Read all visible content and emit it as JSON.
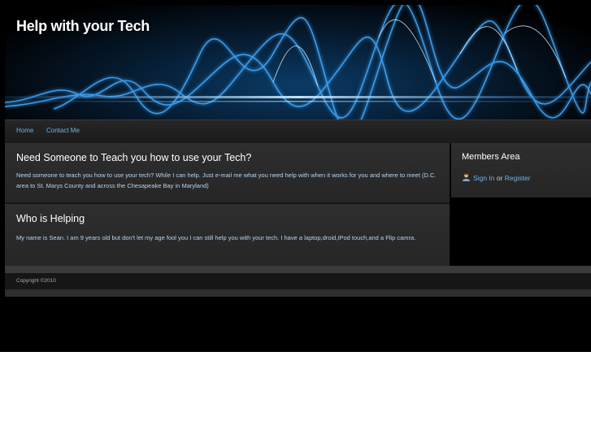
{
  "header": {
    "title": "Help with your Tech"
  },
  "nav": {
    "items": [
      {
        "label": "Home"
      },
      {
        "label": "Contact Me"
      }
    ]
  },
  "main": {
    "sections": [
      {
        "heading": "Need Someone to Teach you how to use your Tech?",
        "body": "Need someone to teach you how to use your tech? While I can help. Just e-mail me what you need help with when it works for you and where to meet (D.C. area to St. Marys County and across the Chesapeake Bay in Maryland)"
      },
      {
        "heading": "Who is Helping",
        "body": "My name is Sean. I am 9 years old but don't let my age fool you I can still help you with your tech. I have a laptop,droid,IPod touch,and a Flip camra."
      }
    ]
  },
  "sidebar": {
    "title": "Members Area",
    "sign_in": "Sign In",
    "or": "or",
    "register": "Register",
    "icon": "user-icon"
  },
  "footer": {
    "copyright": "Copyright ©2010"
  },
  "colors": {
    "link": "#6fb3e6",
    "body_text": "#b8d4ee",
    "background": "#000000",
    "panel": "#2a2a2a",
    "wave_glow": "#3fa9ff"
  }
}
